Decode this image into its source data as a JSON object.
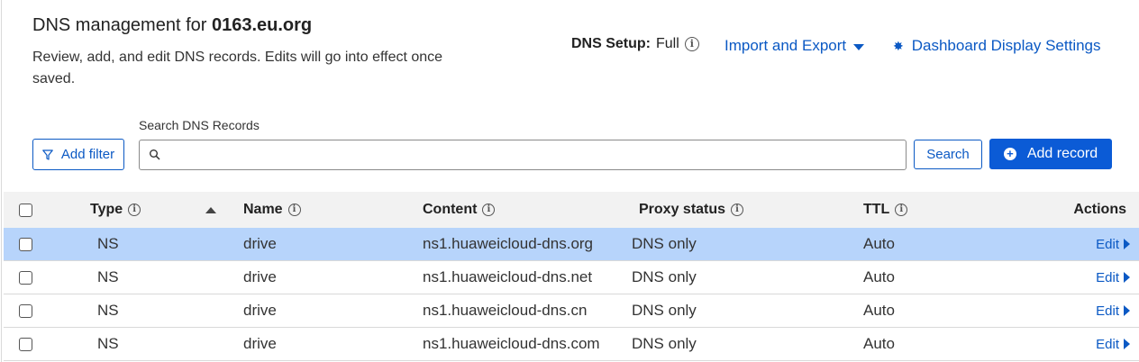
{
  "header": {
    "title_prefix": "DNS management for ",
    "domain": "0163.eu.org",
    "description": "Review, add, and edit DNS records. Edits will go into effect once saved.",
    "dns_setup_label": "DNS Setup:",
    "dns_setup_value": "Full",
    "import_export_label": "Import and Export",
    "dashboard_settings_label": "Dashboard Display Settings"
  },
  "toolbar": {
    "add_filter_label": "Add filter",
    "search_label": "Search DNS Records",
    "search_value": "",
    "search_button_label": "Search",
    "add_record_label": "Add record"
  },
  "table": {
    "columns": {
      "type": "Type",
      "name": "Name",
      "content": "Content",
      "proxy_status": "Proxy status",
      "ttl": "TTL",
      "actions": "Actions"
    },
    "rows": [
      {
        "type": "NS",
        "name": "drive",
        "content": "ns1.huaweicloud-dns.org",
        "proxy_status": "DNS only",
        "ttl": "Auto",
        "action": "Edit",
        "selected": true
      },
      {
        "type": "NS",
        "name": "drive",
        "content": "ns1.huaweicloud-dns.net",
        "proxy_status": "DNS only",
        "ttl": "Auto",
        "action": "Edit",
        "selected": false
      },
      {
        "type": "NS",
        "name": "drive",
        "content": "ns1.huaweicloud-dns.cn",
        "proxy_status": "DNS only",
        "ttl": "Auto",
        "action": "Edit",
        "selected": false
      },
      {
        "type": "NS",
        "name": "drive",
        "content": "ns1.huaweicloud-dns.com",
        "proxy_status": "DNS only",
        "ttl": "Auto",
        "action": "Edit",
        "selected": false
      }
    ]
  },
  "icons": {
    "info": "info-circle-icon",
    "dropdown": "caret-down-icon",
    "settings": "gear-icon",
    "filter": "funnel-icon",
    "search": "magnifier-icon",
    "add": "plus-circle-icon",
    "sort": "sort-ascending-icon",
    "edit_arrow": "caret-right-icon"
  },
  "colors": {
    "accent": "#0b59c4",
    "primary_button": "#0b5bd6",
    "selected_row": "#b7d4fb",
    "header_bg": "#f2f2f2"
  }
}
